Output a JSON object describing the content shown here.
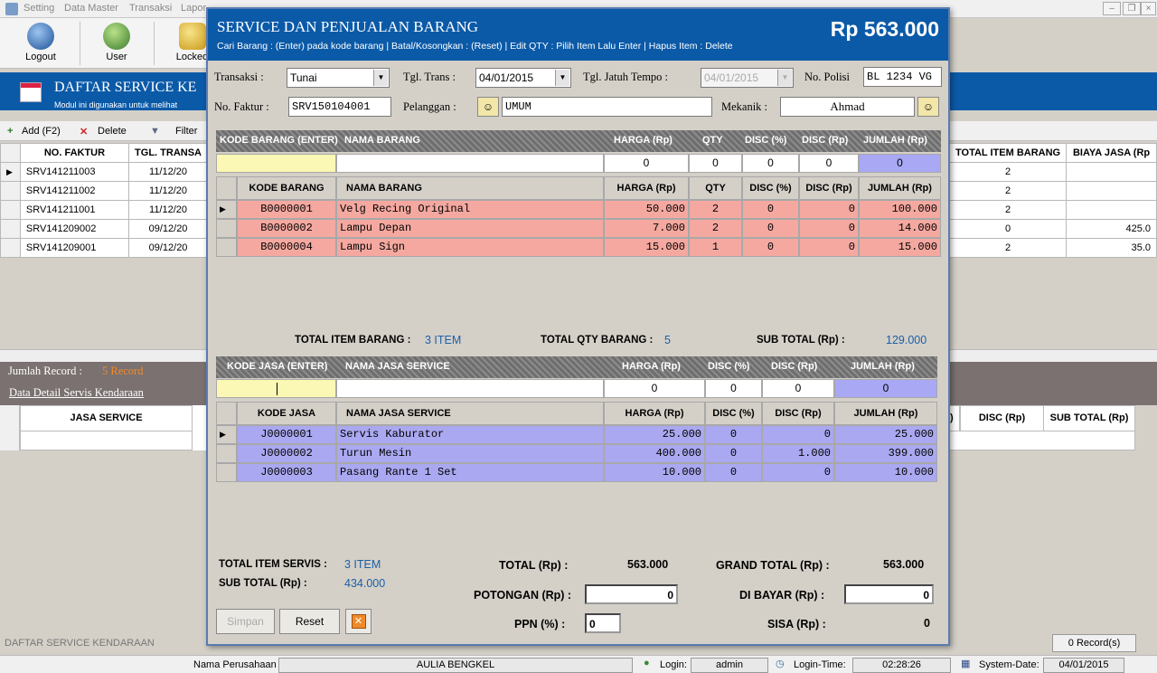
{
  "menu": [
    "Setting",
    "Data Master",
    "Transaksi",
    "Lapor"
  ],
  "toolbar": [
    {
      "label": "Logout",
      "icon": "key-icon"
    },
    {
      "label": "User",
      "icon": "users-icon"
    },
    {
      "label": "Locked",
      "icon": "lock-icon"
    }
  ],
  "banner": {
    "title": "DAFTAR SERVICE KE",
    "subtitle": "Modul ini digunakan untuk melihat"
  },
  "subbar": {
    "add": "Add (F2)",
    "delete": "Delete",
    "filter": "Filter"
  },
  "bg_table": {
    "headers": [
      "NO. FAKTUR",
      "TGL. TRANSA"
    ],
    "rows": [
      [
        "SRV141211003",
        "11/12/20"
      ],
      [
        "SRV141211002",
        "11/12/20"
      ],
      [
        "SRV141211001",
        "11/12/20"
      ],
      [
        "SRV141209002",
        "09/12/20"
      ],
      [
        "SRV141209001",
        "09/12/20"
      ]
    ],
    "right_headers": [
      "TOTAL ITEM BARANG",
      "BIAYA JASA (Rp"
    ],
    "right_rows": [
      [
        "2",
        ""
      ],
      [
        "2",
        ""
      ],
      [
        "2",
        ""
      ],
      [
        "0",
        "425.0"
      ],
      [
        "2",
        "35.0"
      ]
    ]
  },
  "jumlah_record": {
    "label": "Jumlah Record :",
    "value": "5 Record"
  },
  "detail_link": "Data Detail Servis Kendaraan",
  "detail_headers": [
    "JASA SERVICE"
  ],
  "detail_right_headers": [
    ")",
    "DISC (Rp)",
    "SUB TOTAL (Rp)"
  ],
  "footer_left": "DAFTAR SERVICE KENDARAAN",
  "footer_records": "0 Record(s)",
  "statusbar": {
    "company_label": "Nama Perusahaan",
    "company": "AULIA BENGKEL",
    "login_label": "Login:",
    "login": "admin",
    "time_label": "Login-Time:",
    "time": "02:28:26",
    "date_label": "System-Date:",
    "date": "04/01/2015"
  },
  "dialog": {
    "title": "SERVICE DAN PENJUALAN BARANG",
    "hint": "Cari Barang : (Enter) pada kode barang | Batal/Kosongkan : (Reset) | Edit QTY : Pilih Item Lalu Enter | Hapus Item : Delete",
    "amount": "Rp 563.000",
    "form": {
      "transaksi_label": "Transaksi   :",
      "transaksi": "Tunai",
      "tgltrans_label": "Tgl. Trans   :",
      "tgltrans": "04/01/2015",
      "jatuh_label": "Tgl. Jatuh Tempo   :",
      "jatuh": "04/01/2015",
      "polisi_label": "No. Polisi",
      "polisi": "BL 1234 VG",
      "faktur_label": "No. Faktur   :",
      "faktur": "SRV150104001",
      "pelanggan_label": "Pelanggan   :",
      "pelanggan": "UMUM",
      "mekanik_label": "Mekanik   :",
      "mekanik": "Ahmad"
    },
    "barang": {
      "entry_headers": [
        "KODE BARANG (ENTER)",
        "NAMA BARANG",
        "HARGA (Rp)",
        "QTY",
        "DISC (%)",
        "DISC (Rp)",
        "JUMLAH (Rp)"
      ],
      "entry_values": [
        "",
        "",
        "0",
        "0",
        "0",
        "0",
        "0"
      ],
      "headers": [
        "KODE BARANG",
        "NAMA BARANG",
        "HARGA (Rp)",
        "QTY",
        "DISC (%)",
        "DISC (Rp)",
        "JUMLAH (Rp)"
      ],
      "rows": [
        [
          "B0000001",
          "Velg Recing Original",
          "50.000",
          "2",
          "0",
          "0",
          "100.000"
        ],
        [
          "B0000002",
          "Lampu Depan",
          "7.000",
          "2",
          "0",
          "0",
          "14.000"
        ],
        [
          "B0000004",
          "Lampu Sign",
          "15.000",
          "1",
          "0",
          "0",
          "15.000"
        ]
      ],
      "total_item_label": "TOTAL ITEM BARANG   :",
      "total_item": "3 ITEM",
      "total_qty_label": "TOTAL QTY BARANG   :",
      "total_qty": "5",
      "subtotal_label": "SUB TOTAL (Rp)   :",
      "subtotal": "129.000"
    },
    "jasa": {
      "entry_headers": [
        "KODE JASA (ENTER)",
        "NAMA JASA SERVICE",
        "HARGA (Rp)",
        "DISC (%)",
        "DISC (Rp)",
        "JUMLAH (Rp)"
      ],
      "entry_values": [
        "",
        "",
        "0",
        "0",
        "0",
        "0"
      ],
      "headers": [
        "KODE JASA",
        "NAMA JASA SERVICE",
        "HARGA (Rp)",
        "DISC (%)",
        "DISC (Rp)",
        "JUMLAH (Rp)"
      ],
      "rows": [
        [
          "J0000001",
          "Servis Kaburator",
          "25.000",
          "0",
          "0",
          "25.000"
        ],
        [
          "J0000002",
          "Turun Mesin",
          "400.000",
          "0",
          "1.000",
          "399.000"
        ],
        [
          "J0000003",
          "Pasang Rante 1 Set",
          "10.000",
          "0",
          "0",
          "10.000"
        ]
      ]
    },
    "summary": {
      "item_servis_label": "TOTAL ITEM SERVIS   :",
      "item_servis": "3 ITEM",
      "sub_total_label": "SUB TOTAL (Rp)       :",
      "sub_total": "434.000",
      "total_label": "TOTAL (Rp)   :",
      "total": "563.000",
      "potongan_label": "POTONGAN (Rp)   :",
      "potongan": "0",
      "ppn_label": "PPN (%)   :",
      "ppn": "0",
      "grand_label": "GRAND TOTAL (Rp)   :",
      "grand": "563.000",
      "bayar_label": "DI BAYAR (Rp)   :",
      "bayar": "0",
      "sisa_label": "SISA (Rp)   :",
      "sisa": "0"
    },
    "buttons": {
      "simpan": "Simpan",
      "reset": "Reset"
    }
  },
  "colors": {
    "accent": "#0b5aa8",
    "barang_row": "#f4a8a0",
    "jasa_row": "#aaa8f0",
    "entry_yellow": "#fbf7b4",
    "entry_lavender": "#a8a8f4"
  }
}
